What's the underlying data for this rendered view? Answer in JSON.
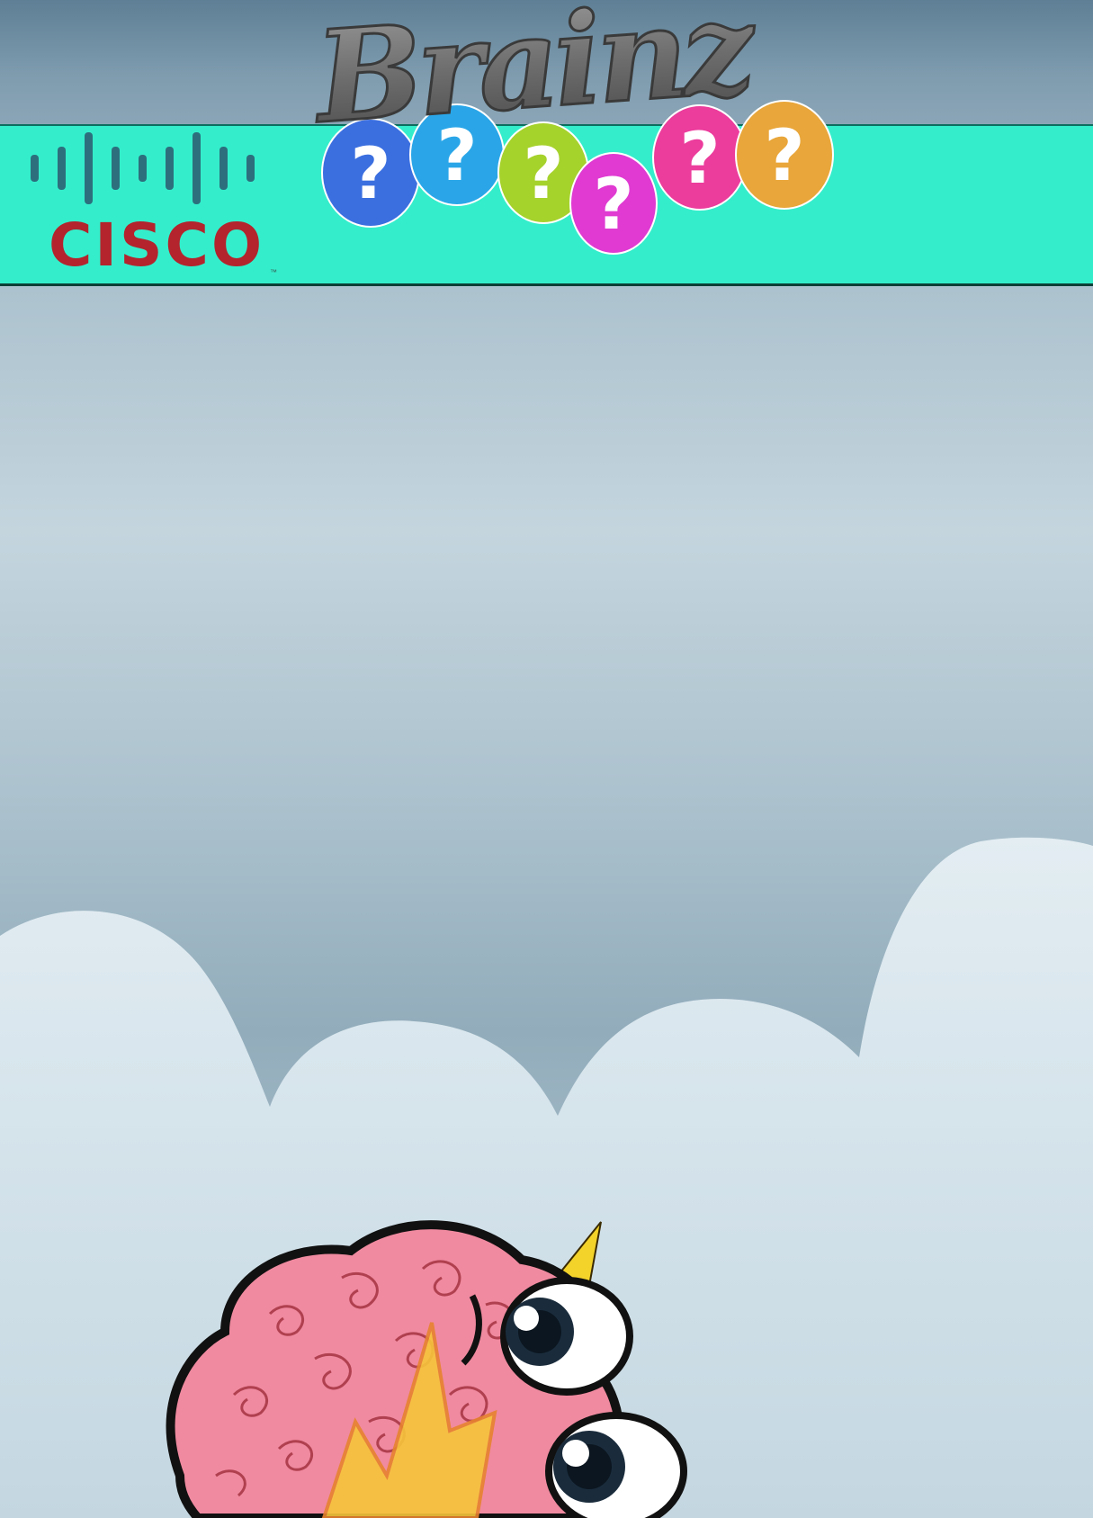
{
  "brand": {
    "logo_text": "CISCO",
    "tm": "™",
    "logo_color": "#b3242d",
    "bars_color": "#2d6f7d"
  },
  "title": {
    "text": "Brainz",
    "balloon_glyph": "?",
    "balloon_colors": [
      "#3b6fe0",
      "#2aa6e8",
      "#a6d22c",
      "#e03ad2",
      "#ec3c9c",
      "#e9a63a"
    ]
  },
  "colors": {
    "banner": "#34eecb",
    "brain_pink": "#f08aa0",
    "bolt": "#f6c53b"
  },
  "mascot": {
    "icon": "brain-mascot-icon"
  }
}
